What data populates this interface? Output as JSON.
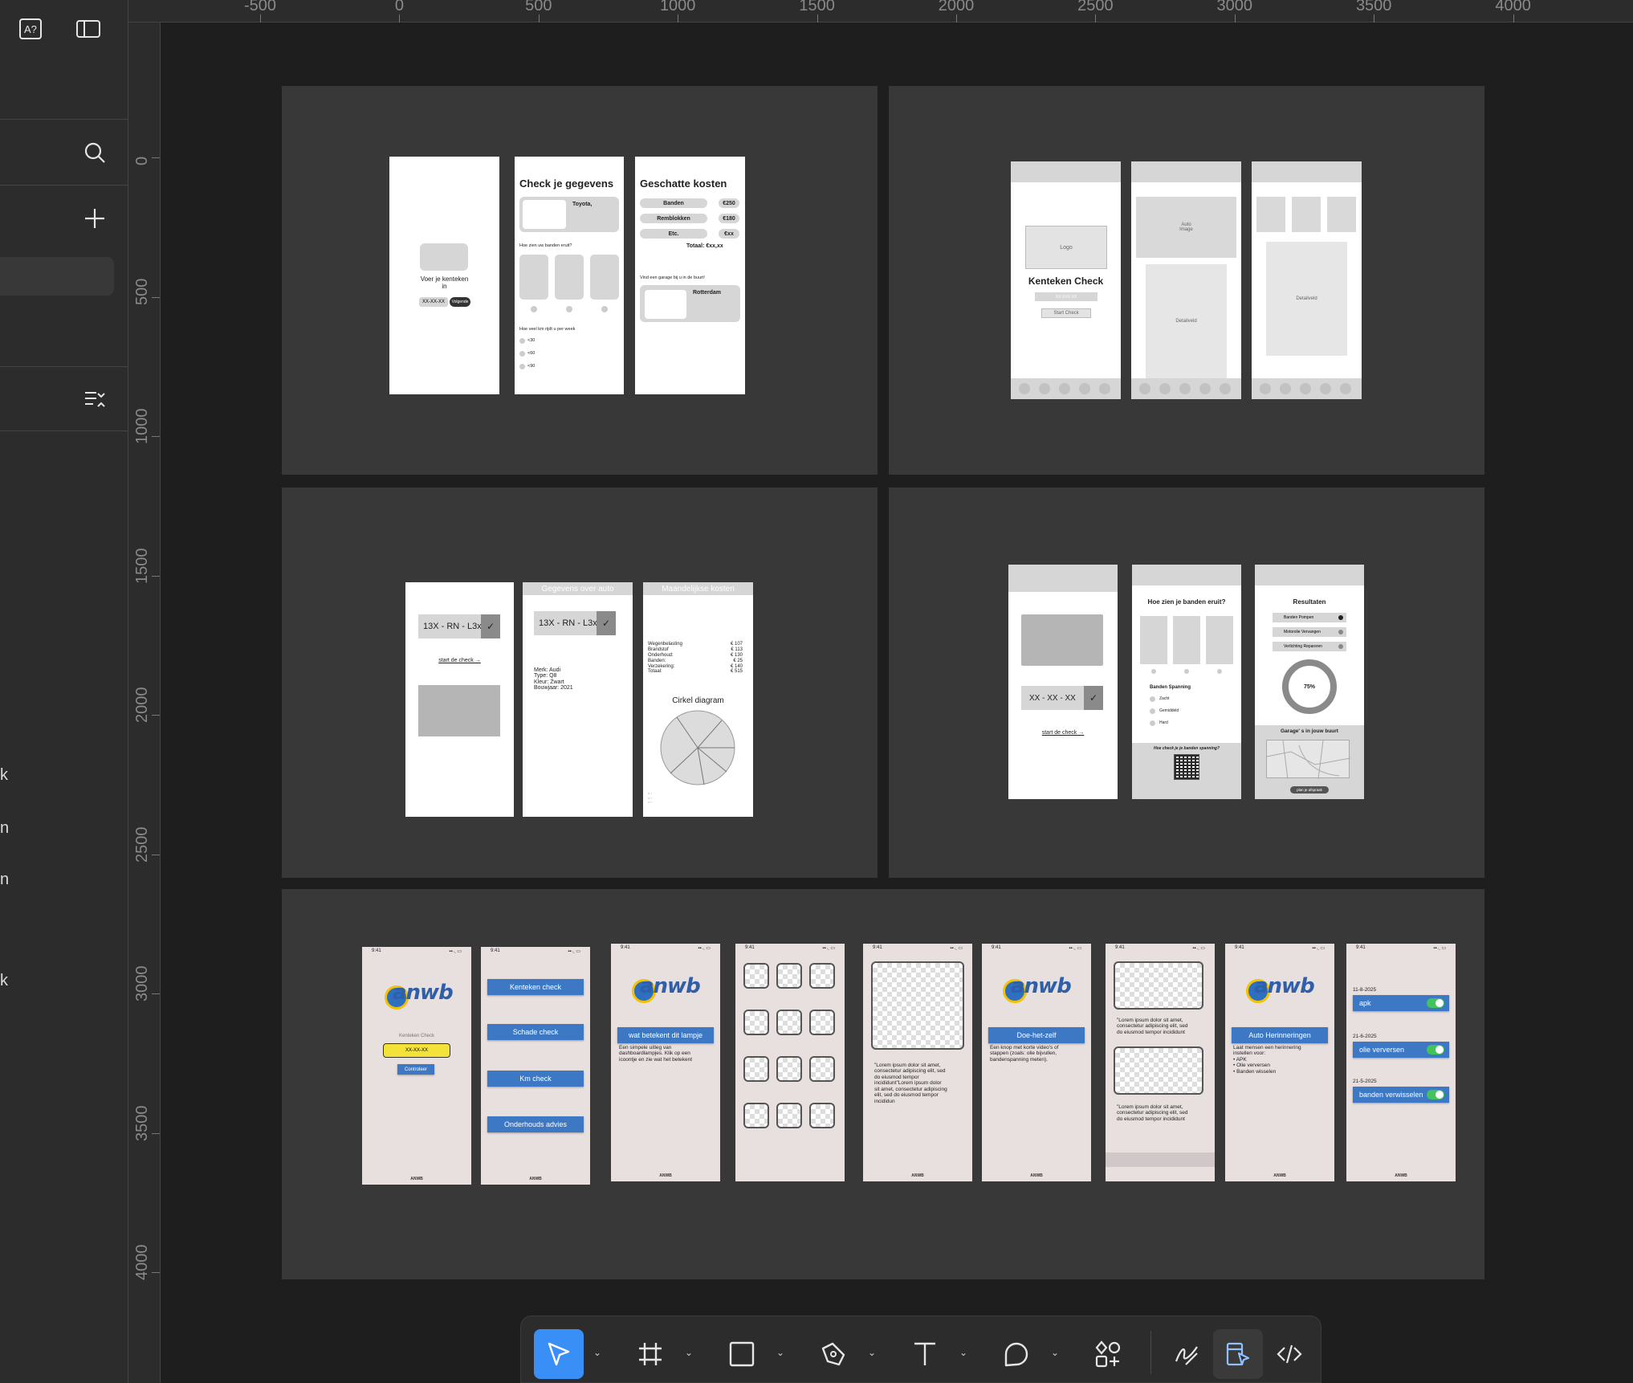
{
  "ruler": {
    "x_labels": [
      "-500",
      "0",
      "500",
      "1000",
      "1500",
      "2000",
      "2500",
      "3000",
      "3500",
      "4000"
    ],
    "y_labels": [
      "0",
      "500",
      "1000",
      "1500",
      "2000",
      "2500",
      "3000",
      "3500",
      "4000"
    ]
  },
  "left_panel": {
    "icons": [
      "ai-text-icon",
      "sidebar-toggle-icon",
      "search-icon",
      "plus-icon",
      "list-collapse-icon"
    ],
    "fragments": [
      "k",
      "n",
      "n",
      "k"
    ]
  },
  "frames": {
    "s1": {
      "p1": {
        "prompt": "Voer je kenteken\nin",
        "plate": "XX-XX-XX",
        "btn": "Volgende"
      },
      "p2": {
        "title": "Check je gegevens",
        "car": "Toyota,",
        "q1": "Hoe zien uw banden eruit?",
        "q2": "Hoe veel km rijdt u per week",
        "opts": [
          "<30",
          "<60",
          "<90"
        ]
      },
      "p3": {
        "title": "Geschatte kosten",
        "rows": [
          {
            "k": "Banden",
            "v": "€250"
          },
          {
            "k": "Remblokken",
            "v": "€180"
          },
          {
            "k": "Etc.",
            "v": "€xx"
          }
        ],
        "total": "Totaal: €xx,xx",
        "garage_q": "Vind een garage bij u in de buurt!",
        "city": "Rotterdam"
      }
    },
    "s2": {
      "p1": {
        "logo": "Logo",
        "title": "Kenteken Check",
        "plate": "XX-XXX-XX",
        "btn": "Start Check"
      },
      "p2": {
        "image": "Auto\nImage",
        "detail": "Detailveld"
      },
      "p3": {
        "detail": "Detailveld"
      }
    },
    "s3": {
      "p1": {
        "plate": "13X - RN - L3x",
        "link": "start de check →"
      },
      "p2": {
        "header": "Gegevens over auto",
        "plate": "13X - RN - L3x",
        "info": "Merk: Audi\nType: Q8\nKleur: Zwart\nBouwjaar: 2021"
      },
      "p3": {
        "header": "Maandelijkse kosten",
        "costs": [
          {
            "k": "Wegenbelasting",
            "v": "€ 107"
          },
          {
            "k": "Brandstof",
            "v": "€ 113"
          },
          {
            "k": "Onderhoud:",
            "v": "€ 130"
          },
          {
            "k": "Banden:",
            "v": "€ 25"
          },
          {
            "k": "Verzekering:",
            "v": "€ 140"
          },
          {
            "k": "Totaal:",
            "v": "€ 515"
          }
        ],
        "chart_title": "Cirkel diagram"
      }
    },
    "s4": {
      "p1": {
        "plate": "XX - XX - XX",
        "link": "start de check →"
      },
      "p2": {
        "title": "Hoe zien je banden eruit?",
        "pressure": "Banden Spanning",
        "opts": [
          "Zacht",
          "Gemiddeld",
          "Hard"
        ],
        "qr_q": "Hoe check je je banden spanning?"
      },
      "p3": {
        "title": "Resultaten",
        "items": [
          "Banden Pompen",
          "Motorolie Vervangen",
          "Verlichting Repareren"
        ],
        "progress": "75%",
        "garage": "Garage' s in jouw buurt",
        "btn": "plan je afspraak"
      }
    },
    "s5": {
      "time": "9:41",
      "logo": "anwb",
      "footer": "ANWB",
      "p1": {
        "label": "Kenteken Check",
        "plate": "XX-XX-XX",
        "btn": "Controleer"
      },
      "p2": {
        "btns": [
          "Kenteken check",
          "Schade check",
          "Km check",
          "Onderhouds advies"
        ]
      },
      "p3": {
        "btn": "wat betekent dit lampje",
        "text": "Een simpele uitleg van\ndashboardlampjes. Klik op een\nicoontje en zie wat het betekent"
      },
      "p5": {
        "text": "\"Lorem ipsum dolor sit amet,\nconsectetur adipiscing elit, sed\ndo eiusmod tempor\nincididunt\"Lorem ipsum dolor\nsit amet, consectetur adipiscing\nelit, sed do eiusmod tempor\nincididun"
      },
      "p6": {
        "btn": "Doe-het-zelf",
        "text": "Een knop met korte video's of\nstappen (zoals: olie bijvullen,\nbandenspanning meten)."
      },
      "p7": {
        "text1": "\"Lorem ipsum dolor sit amet,\nconsectetur adipiscing elit, sed\ndo eiusmod tempor incididunt",
        "text2": "\"Lorem ipsum dolor sit amet,\nconsectetur adipiscing elit, sed\ndo eiusmod tempor incididunt"
      },
      "p8": {
        "btn": "Auto Herinneringen",
        "text": "Laat mensen een herinnering\ninstellen voor:\n  • APK\n  • Olie verversen\n  • Banden wisselen"
      },
      "p9": {
        "reminders": [
          {
            "date": "11-8-2025",
            "label": "apk"
          },
          {
            "date": "21-6-2025",
            "label": "olie verversen"
          },
          {
            "date": "21-5-2025",
            "label": "banden verwisselen"
          }
        ]
      }
    }
  },
  "toolbar": {
    "tools": [
      "move-tool",
      "frame-tool",
      "rectangle-tool",
      "pen-tool",
      "text-tool",
      "comment-tool",
      "actions-tool"
    ],
    "modes": [
      "draw-mode",
      "design-mode",
      "dev-mode"
    ],
    "active": "move-tool"
  },
  "colors": {
    "accent": "#3a8ff7",
    "anwb_blue": "#3d78c5",
    "anwb_yellow": "#f3e23a",
    "toggle_green": "#43c35b"
  }
}
